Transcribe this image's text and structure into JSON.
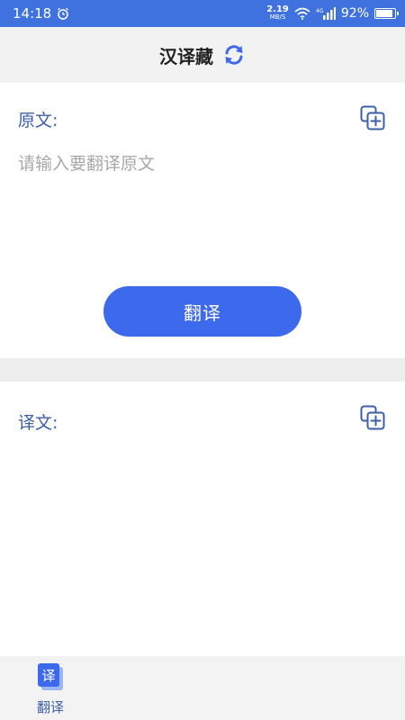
{
  "status_bar": {
    "time": "14:18",
    "net_speed_value": "2.19",
    "net_speed_unit": "MB/S",
    "network": "4G",
    "battery_text": "92%",
    "battery_level": 0.92
  },
  "header": {
    "title": "汉译藏",
    "swap_icon": "swap-icon"
  },
  "source": {
    "label": "原文:",
    "placeholder": "请输入要翻译原文",
    "value": "",
    "copy_icon": "copy-add-icon"
  },
  "translate_button": {
    "label": "翻译"
  },
  "result": {
    "label": "译文:",
    "value": "",
    "copy_icon": "copy-add-icon"
  },
  "bottom_nav": {
    "items": [
      {
        "label": "翻译",
        "icon_text": "译",
        "active": true
      }
    ]
  },
  "colors": {
    "accent": "#3d6aed",
    "status_bar": "#3f72df",
    "label": "#3d5fa8"
  }
}
